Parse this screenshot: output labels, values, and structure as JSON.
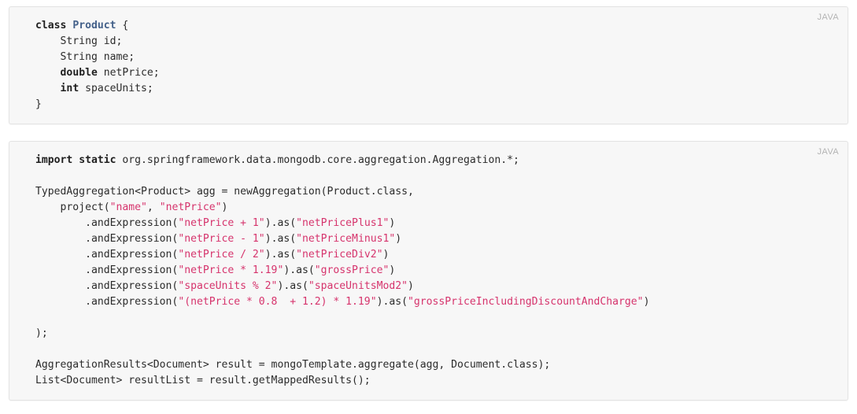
{
  "page": {
    "background": "#ffffff",
    "panel_background": "#f7f7f7",
    "panel_border": "#e3e3e3",
    "string_color": "#d6336c",
    "type_color": "#44618a",
    "keyword_color": "#1f1f1f",
    "plain_color": "#2b2b2b",
    "lang_tag_color": "#b4b4b4"
  },
  "blocks": [
    {
      "language_label": "JAVA",
      "lines": [
        [
          {
            "t": "class",
            "c": "kw"
          },
          {
            "t": " ",
            "c": "pl"
          },
          {
            "t": "Product",
            "c": "type"
          },
          {
            "t": " {",
            "c": "pl"
          }
        ],
        [
          {
            "t": "    String id;",
            "c": "pl"
          }
        ],
        [
          {
            "t": "    String name;",
            "c": "pl"
          }
        ],
        [
          {
            "t": "    ",
            "c": "pl"
          },
          {
            "t": "double",
            "c": "kw"
          },
          {
            "t": " netPrice;",
            "c": "pl"
          }
        ],
        [
          {
            "t": "    ",
            "c": "pl"
          },
          {
            "t": "int",
            "c": "kw"
          },
          {
            "t": " spaceUnits;",
            "c": "pl"
          }
        ],
        [
          {
            "t": "}",
            "c": "pl"
          }
        ]
      ]
    },
    {
      "language_label": "JAVA",
      "lines": [
        [
          {
            "t": "import",
            "c": "kw"
          },
          {
            "t": " ",
            "c": "pl"
          },
          {
            "t": "static",
            "c": "kw"
          },
          {
            "t": " org.springframework.data.mongodb.core.aggregation.Aggregation.*;",
            "c": "pl"
          }
        ],
        [
          {
            "t": "",
            "c": "pl"
          }
        ],
        [
          {
            "t": "TypedAggregation<Product> agg = newAggregation(Product.class,",
            "c": "pl"
          }
        ],
        [
          {
            "t": "    project(",
            "c": "pl"
          },
          {
            "t": "\"name\"",
            "c": "str"
          },
          {
            "t": ", ",
            "c": "pl"
          },
          {
            "t": "\"netPrice\"",
            "c": "str"
          },
          {
            "t": ")",
            "c": "pl"
          }
        ],
        [
          {
            "t": "        .andExpression(",
            "c": "pl"
          },
          {
            "t": "\"netPrice + 1\"",
            "c": "str"
          },
          {
            "t": ").as(",
            "c": "pl"
          },
          {
            "t": "\"netPricePlus1\"",
            "c": "str"
          },
          {
            "t": ")",
            "c": "pl"
          }
        ],
        [
          {
            "t": "        .andExpression(",
            "c": "pl"
          },
          {
            "t": "\"netPrice - 1\"",
            "c": "str"
          },
          {
            "t": ").as(",
            "c": "pl"
          },
          {
            "t": "\"netPriceMinus1\"",
            "c": "str"
          },
          {
            "t": ")",
            "c": "pl"
          }
        ],
        [
          {
            "t": "        .andExpression(",
            "c": "pl"
          },
          {
            "t": "\"netPrice / 2\"",
            "c": "str"
          },
          {
            "t": ").as(",
            "c": "pl"
          },
          {
            "t": "\"netPriceDiv2\"",
            "c": "str"
          },
          {
            "t": ")",
            "c": "pl"
          }
        ],
        [
          {
            "t": "        .andExpression(",
            "c": "pl"
          },
          {
            "t": "\"netPrice * 1.19\"",
            "c": "str"
          },
          {
            "t": ").as(",
            "c": "pl"
          },
          {
            "t": "\"grossPrice\"",
            "c": "str"
          },
          {
            "t": ")",
            "c": "pl"
          }
        ],
        [
          {
            "t": "        .andExpression(",
            "c": "pl"
          },
          {
            "t": "\"spaceUnits % 2\"",
            "c": "str"
          },
          {
            "t": ").as(",
            "c": "pl"
          },
          {
            "t": "\"spaceUnitsMod2\"",
            "c": "str"
          },
          {
            "t": ")",
            "c": "pl"
          }
        ],
        [
          {
            "t": "        .andExpression(",
            "c": "pl"
          },
          {
            "t": "\"(netPrice * 0.8  + 1.2) * 1.19\"",
            "c": "str"
          },
          {
            "t": ").as(",
            "c": "pl"
          },
          {
            "t": "\"grossPriceIncludingDiscountAndCharge\"",
            "c": "str"
          },
          {
            "t": ")",
            "c": "pl"
          }
        ],
        [
          {
            "t": "",
            "c": "pl"
          }
        ],
        [
          {
            "t": ");",
            "c": "pl"
          }
        ],
        [
          {
            "t": "",
            "c": "pl"
          }
        ],
        [
          {
            "t": "AggregationResults<Document> result = mongoTemplate.aggregate(agg, Document.class);",
            "c": "pl"
          }
        ],
        [
          {
            "t": "List<Document> resultList = result.getMappedResults();",
            "c": "pl"
          }
        ]
      ]
    }
  ]
}
